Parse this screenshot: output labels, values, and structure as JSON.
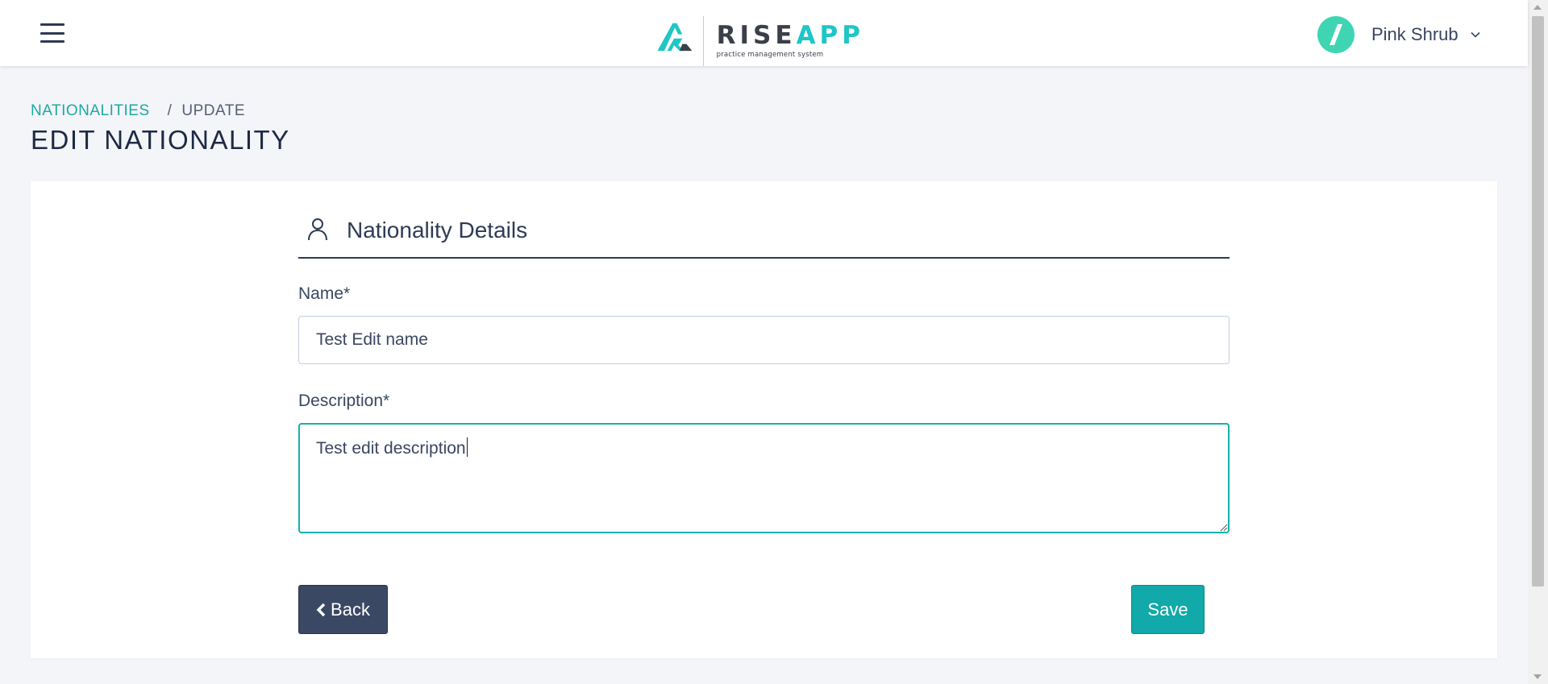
{
  "header": {
    "menu_icon": "hamburger-menu-icon",
    "logo": {
      "word_rise": "RISE",
      "word_app": "APP",
      "tagline": "practice management system",
      "accent_color": "#1fc6c6"
    },
    "user": {
      "name": "Pink Shrub",
      "avatar_color": "#3fd5b3",
      "avatar_icon": "slash-icon",
      "dropdown_icon": "chevron-down-icon"
    }
  },
  "breadcrumb": {
    "link": "NATIONALITIES",
    "separator": "/",
    "current": "UPDATE"
  },
  "page_title": "EDIT NATIONALITY",
  "form": {
    "section_icon": "person-icon",
    "section_title": "Nationality Details",
    "name": {
      "label": "Name*",
      "value": "Test Edit name"
    },
    "description": {
      "label": "Description*",
      "value": "Test edit description"
    },
    "back_label": "Back",
    "back_icon": "chevron-left-icon",
    "save_label": "Save"
  },
  "colors": {
    "primary_teal": "#11a9a9",
    "dark_button": "#3b4864",
    "link_teal": "#1aa9a5"
  }
}
